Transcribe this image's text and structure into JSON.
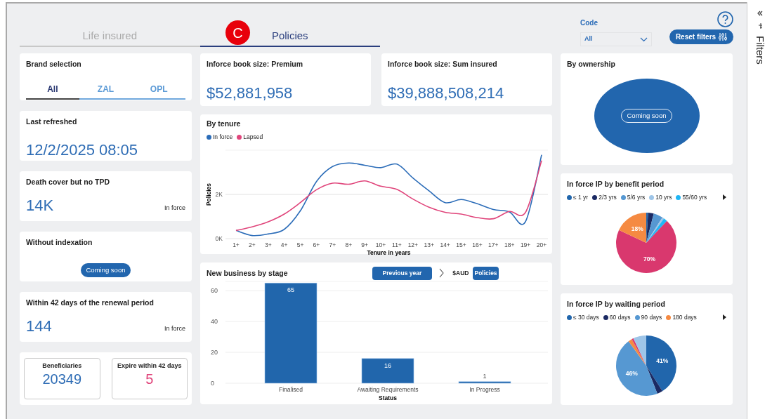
{
  "header": {
    "tabs": [
      {
        "label": "Life insured",
        "selected": false
      },
      {
        "label": "Policies",
        "selected": true
      }
    ],
    "marker": "C",
    "code_filter": {
      "label": "Code",
      "value": "All"
    },
    "reset_button": "Reset filters"
  },
  "brand_selection": {
    "title": "Brand selection",
    "options": [
      {
        "label": "All",
        "selected": true
      },
      {
        "label": "ZAL",
        "selected": false
      },
      {
        "label": "OPL",
        "selected": false
      }
    ]
  },
  "inforce_premium": {
    "title": "Inforce book size: Premium",
    "value": "$52,881,958"
  },
  "inforce_sum_insured": {
    "title": "Inforce book size: Sum insured",
    "value": "$39,888,508,214"
  },
  "last_refreshed": {
    "title": "Last refreshed",
    "value": "12/2/2025 08:05"
  },
  "death_cover_no_tpd": {
    "title": "Death cover but no TPD",
    "value": "14K",
    "note": "In force"
  },
  "without_indexation": {
    "title": "Without indexation",
    "badge": "Coming soon"
  },
  "renewal_period": {
    "title": "Within 42 days of the renewal period",
    "value": "144",
    "note": "In force"
  },
  "beneficiaries": {
    "label": "Beneficiaries",
    "value": "20349"
  },
  "expire_within_42_days": {
    "label": "Expire within 42 days",
    "value": "5"
  },
  "by_tenure": {
    "chart_data": {
      "type": "line",
      "title": "By tenure",
      "xlabel": "Tenure in years",
      "ylabel": "Policies",
      "categories": [
        "1+",
        "2+",
        "3+",
        "4+",
        "5+",
        "6+",
        "7+",
        "8+",
        "9+",
        "10+",
        "11+",
        "12+",
        "13+",
        "14+",
        "15+",
        "16+",
        "17+",
        "18+",
        "19+",
        "20+"
      ],
      "yticks": [
        {
          "value": 0,
          "label": "0K"
        },
        {
          "value": 2000,
          "label": "2K"
        }
      ],
      "grid": true,
      "ylim": [
        0,
        4000
      ],
      "series": [
        {
          "name": "In force",
          "color": "#2b6cb8",
          "values": [
            370,
            140,
            210,
            420,
            1260,
            2580,
            3260,
            3420,
            3320,
            3210,
            3370,
            2740,
            2160,
            1630,
            1770,
            1580,
            1320,
            1210,
            770,
            3790
          ]
        },
        {
          "name": "Lapsed",
          "color": "#e0457b",
          "values": [
            370,
            530,
            760,
            1110,
            1630,
            2210,
            2510,
            2460,
            2610,
            2370,
            2230,
            1790,
            1420,
            1190,
            1110,
            950,
            900,
            1230,
            1190,
            3530
          ]
        }
      ]
    }
  },
  "new_business": {
    "period_button": "Previous year",
    "toggles": [
      {
        "label": "$AUD",
        "selected": false
      },
      {
        "label": "Policies",
        "selected": true
      }
    ],
    "chart_data": {
      "type": "bar",
      "title": "New business by stage",
      "xlabel": "Status",
      "categories": [
        "Finalised",
        "Awaiting Requirements",
        "In Progress"
      ],
      "yticks": [
        0,
        20,
        40,
        60
      ],
      "grid": true,
      "ylim": [
        0,
        66
      ],
      "data_labels": true,
      "series": [
        {
          "color": "#2166ac",
          "values": [
            65,
            16,
            1
          ]
        }
      ]
    }
  },
  "by_ownership": {
    "title": "By ownership",
    "badge": "Coming soon"
  },
  "benefit_period": {
    "title": "In force IP by benefit period",
    "legend": [
      {
        "label": "≤ 1 yr",
        "color": "#2166ac"
      },
      {
        "label": "2/3 yrs",
        "color": "#1b2a63"
      },
      {
        "label": "5/6 yrs",
        "color": "#5698d2"
      },
      {
        "label": "10 yrs",
        "color": "#9ec5e8"
      },
      {
        "label": "55/60 yrs",
        "color": "#1fb6f5"
      }
    ],
    "slices": [
      {
        "color": "#2166ac"
      },
      {
        "color": "#1b2a63"
      },
      {
        "color": "#5698d2"
      },
      {
        "color": "#9ec5e8"
      },
      {
        "color": "#1fb6f5"
      },
      {
        "color": "#d9386e"
      },
      {
        "color": "#f58a42"
      }
    ],
    "chart_data": {
      "type": "pie",
      "values": [
        1,
        3,
        5,
        1,
        2,
        70,
        18
      ],
      "value_labels": [
        null,
        null,
        null,
        null,
        null,
        "70%",
        "18%"
      ]
    }
  },
  "waiting_period": {
    "title": "In force IP by waiting period",
    "legend": [
      {
        "label": "≤ 30 days",
        "color": "#2166ac"
      },
      {
        "label": "60 days",
        "color": "#1b2a63"
      },
      {
        "label": "90 days",
        "color": "#5698d2"
      },
      {
        "label": "180 days",
        "color": "#f58a42"
      }
    ],
    "slices": [
      {
        "color": "#2166ac"
      },
      {
        "color": "#1b2a63"
      },
      {
        "color": "#5698d2"
      },
      {
        "color": "#f58a42"
      },
      {
        "color": "#d9386e"
      },
      {
        "color": "#9ec5e8"
      }
    ],
    "chart_data": {
      "type": "pie",
      "values": [
        41,
        3,
        46,
        2,
        1,
        7
      ],
      "value_labels": [
        "41%",
        null,
        "46%",
        null,
        null,
        null
      ]
    }
  },
  "sidebar": {
    "label": "Filters"
  }
}
